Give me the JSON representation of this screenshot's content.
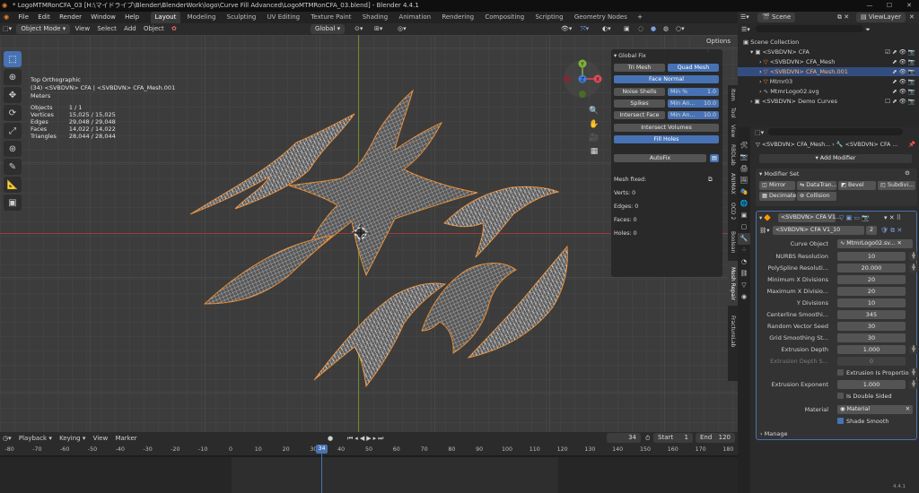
{
  "titlebar": {
    "title": "* LogoMTMRonCFA_03 [H:\\マイドライブ\\Blender\\BlenderWork\\logo\\Curve Fill Advanced\\LogoMTMRonCFA_03.blend] - Blender 4.4.1"
  },
  "menu": {
    "items": [
      "File",
      "Edit",
      "Render",
      "Window",
      "Help"
    ],
    "workspaces": [
      "Layout",
      "Modeling",
      "Sculpting",
      "UV Editing",
      "Texture Paint",
      "Shading",
      "Animation",
      "Rendering",
      "Compositing",
      "Scripting",
      "Geometry Nodes"
    ],
    "scene": "Scene",
    "view_layer": "ViewLayer"
  },
  "viewport_header": {
    "mode": "Object Mode",
    "menus": [
      "View",
      "Select",
      "Add",
      "Object"
    ],
    "transform_orientation": "Global",
    "options": "Options"
  },
  "overlay": {
    "view": "Top Orthographic",
    "context": "(34) <SVBDVN> CFA | <SVBDVN> CFA_Mesh.001",
    "units": "Meters",
    "stats": [
      {
        "label": "Objects",
        "value": "1 / 1"
      },
      {
        "label": "Vertices",
        "value": "15,025 / 15,025"
      },
      {
        "label": "Edges",
        "value": "29,048 / 29,048"
      },
      {
        "label": "Faces",
        "value": "14,022 / 14,022"
      },
      {
        "label": "Triangles",
        "value": "28,044 / 28,044"
      }
    ]
  },
  "gizmo": {
    "x": "X",
    "y": "Y",
    "z": "Z"
  },
  "npanel": {
    "title": "Global Fix",
    "tri_mesh": "Tri Mesh",
    "quad_mesh": "Quad Mesh",
    "face_normal": "Face Normal",
    "noise_shells": "Noise Shells",
    "min_pct_label": "Min %",
    "min_pct_value": "1.0",
    "spikes": "Spikes",
    "min_an_label": "Min An...",
    "spikes_value": "10.0",
    "intersect_face": "Intersect Face",
    "intersect_value": "10.0",
    "intersect_volumes": "Intersect Volumes",
    "fill_holes": "Fill Holes",
    "autofix": "AutoFix",
    "mesh_fixed": "Mesh fixed:",
    "verts": "Verts: 0",
    "edges": "Edges: 0",
    "faces": "Faces: 0",
    "holes": "Holes: 0"
  },
  "side_tabs": [
    "Item",
    "Tool",
    "View",
    "RBDLab",
    "ANIMAX",
    "OCD 2",
    "Boolean",
    "Mesh Repair",
    "FractureLab"
  ],
  "timeline": {
    "menus": [
      "Playback",
      "Keying",
      "View",
      "Marker"
    ],
    "current_frame": "34",
    "start_label": "Start",
    "start": "1",
    "end_label": "End",
    "end": "120",
    "ticks": [
      "-80",
      "-70",
      "-60",
      "-50",
      "-40",
      "-30",
      "-20",
      "-10",
      "0",
      "10",
      "20",
      "30",
      "40",
      "50",
      "60",
      "70",
      "80",
      "90",
      "100",
      "110",
      "120",
      "130",
      "140",
      "150",
      "160",
      "170",
      "180"
    ]
  },
  "outliner": {
    "rows": [
      {
        "name": "Scene Collection",
        "indent": 0,
        "selected": false
      },
      {
        "name": "<SVBDVN> CFA",
        "indent": 1,
        "selected": false
      },
      {
        "name": "<SVBDVN> CFA_Mesh",
        "indent": 2,
        "selected": false
      },
      {
        "name": "<SVBDVN> CFA_Mesh.001",
        "indent": 2,
        "selected": true
      },
      {
        "name": "Mtmr03",
        "indent": 2,
        "selected": false
      },
      {
        "name": "MtmrLogo02.svg",
        "indent": 2,
        "selected": false
      },
      {
        "name": "<SVBDVN> Demo Curves",
        "indent": 1,
        "selected": false
      }
    ]
  },
  "properties": {
    "breadcrumb_obj": "<SVBDVN> CFA_Mesh...",
    "breadcrumb_mod": "<SVBDVN> CFA ...",
    "add_modifier": "Add Modifier",
    "modifier_set": "Modifier Set",
    "mod_buttons": [
      "Mirror",
      "DataTran...",
      "Bevel",
      "Subdivi...",
      "Decimate",
      "Collision"
    ],
    "modifier_name": "<SVBDVN> CFA V1...",
    "node_group": "<SVBDVN> CFA V1_10",
    "node_users": "2",
    "curve_object_label": "Curve Object",
    "curve_object": "MtmrLogo02.sv...",
    "params": [
      {
        "label": "NURBS Resolution",
        "value": "10"
      },
      {
        "label": "PolySpline Resoluti...",
        "value": "20.000"
      },
      {
        "label": "Minimum X Divisions",
        "value": "20"
      },
      {
        "label": "Maximum X Divisio...",
        "value": "20"
      },
      {
        "label": "Y Divisions",
        "value": "10"
      },
      {
        "label": "Centerline Smoothi...",
        "value": "345"
      },
      {
        "label": "Random Vector Seed",
        "value": "30"
      },
      {
        "label": "Grid Smoothing St...",
        "value": "30"
      },
      {
        "label": "Extrusion Depth",
        "value": "1.000"
      },
      {
        "label": "Extrusion Depth S...",
        "value": "0"
      }
    ],
    "extrusion_prop": "Extrusion Is Proportio...",
    "extrusion_exponent_label": "Extrusion Exponent",
    "extrusion_exponent": "1.000",
    "double_sided": "Is Double Sided",
    "material_label": "Material",
    "material": "Material",
    "shade_smooth": "Shade Smooth",
    "manage": "Manage"
  },
  "version": "4.4.1",
  "colors": {
    "accent": "#4772b3",
    "mesh": "#e0e0e0",
    "selection_outline": "#e8862a"
  }
}
